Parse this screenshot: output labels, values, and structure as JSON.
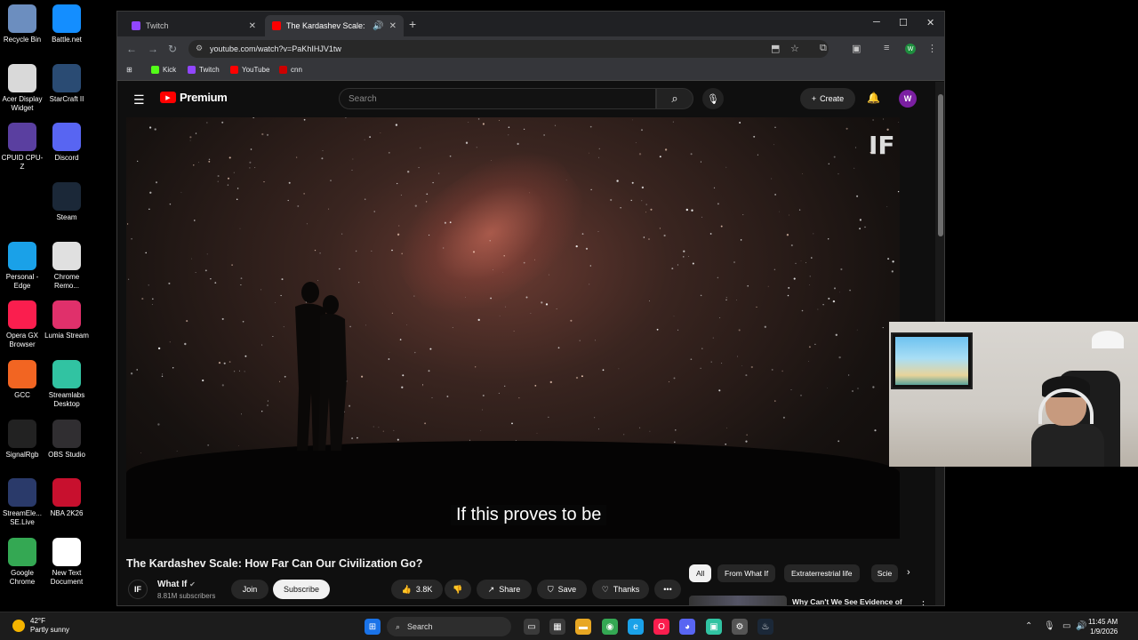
{
  "desktop_icons": [
    {
      "label": "Recycle Bin",
      "icon": "recycle-bin-icon",
      "color": "#6c8ebf"
    },
    {
      "label": "Battle.net",
      "icon": "battlenet-icon",
      "color": "#148eff"
    },
    {
      "label": "Acer Display Widget",
      "icon": "acer-icon",
      "color": "#d9d9d9"
    },
    {
      "label": "StarCraft II",
      "icon": "starcraft-icon",
      "color": "#2a4b73"
    },
    {
      "label": "CPUID CPU-Z",
      "icon": "cpuz-icon",
      "color": "#5a3fa0"
    },
    {
      "label": "Discord",
      "icon": "discord-icon",
      "color": "#5865f2"
    },
    {
      "label": "Steam",
      "icon": "steam-icon",
      "color": "#1b2838"
    },
    {
      "label": "Personal - Edge",
      "icon": "edge-icon",
      "color": "#1aa1e8"
    },
    {
      "label": "Chrome Remo...",
      "icon": "chrome-remote-icon",
      "color": "#e0e0e0"
    },
    {
      "label": "Opera GX Browser",
      "icon": "opera-gx-icon",
      "color": "#fa1e4e"
    },
    {
      "label": "Lumia Stream",
      "icon": "lumia-icon",
      "color": "#e0306b"
    },
    {
      "label": "GCC",
      "icon": "gcc-icon",
      "color": "#f26522"
    },
    {
      "label": "Streamlabs Desktop",
      "icon": "streamlabs-icon",
      "color": "#31c3a2"
    },
    {
      "label": "SignalRgb",
      "icon": "signalrgb-icon",
      "color": "#222222"
    },
    {
      "label": "OBS Studio",
      "icon": "obs-icon",
      "color": "#302e31"
    },
    {
      "label": "StreamEle... SE.Live",
      "icon": "streamelements-icon",
      "color": "#2a3a6a"
    },
    {
      "label": "NBA 2K26",
      "icon": "nba2k-icon",
      "color": "#c8102e"
    },
    {
      "label": "Google Chrome",
      "icon": "chrome-icon",
      "color": "#34a853"
    },
    {
      "label": "New Text Document",
      "icon": "text-document-icon",
      "color": "#ffffff"
    }
  ],
  "browser": {
    "tabs": [
      {
        "title": "Twitch",
        "color": "#9146ff"
      },
      {
        "title": "The Kardashev Scale: How F",
        "color": "#ff0000"
      }
    ],
    "url": "youtube.com/watch?v=PaKhIHJV1tw",
    "bookmarks": [
      {
        "label": "Kick",
        "color": "#53fc18"
      },
      {
        "label": "Twitch",
        "color": "#9146ff"
      },
      {
        "label": "YouTube",
        "color": "#ff0000"
      },
      {
        "label": "cnn",
        "color": "#cc0000"
      }
    ],
    "profile_initial": "W"
  },
  "youtube": {
    "logo_text": "Premium",
    "search_placeholder": "Search",
    "create_label": "Create",
    "avatar_initial": "W",
    "player": {
      "watermark": "IF",
      "caption": "If this proves to be"
    },
    "video": {
      "title": "The Kardashev Scale: How Far Can Our Civilization Go?",
      "channel": "What If",
      "channel_avatar": "IF",
      "subscribers": "8.81M subscribers",
      "join_label": "Join",
      "subscribe_label": "Subscribe",
      "likes": "3.8K",
      "share_label": "Share",
      "save_label": "Save",
      "thanks_label": "Thanks"
    },
    "chips": [
      "All",
      "From What If",
      "Extraterrestrial life",
      "Scie"
    ],
    "recommendation": {
      "title": "Why Can't We See Evidence of Alien Life? | Documentary"
    }
  },
  "taskbar": {
    "weather_temp": "42°F",
    "weather_desc": "Partly sunny",
    "search_label": "Search",
    "time": "11:45 AM",
    "date": "1/9/2026"
  }
}
